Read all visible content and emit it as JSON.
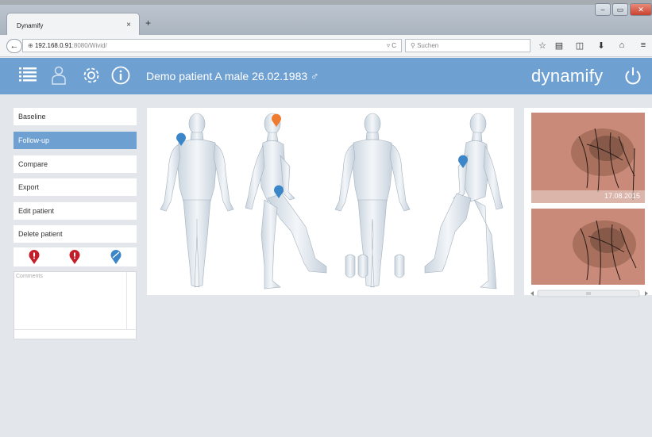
{
  "browser": {
    "tab_title": "Dynamify",
    "tab_close": "×",
    "new_tab": "+",
    "url_host": "192.168.0.91",
    "url_path": ":8080/Wivid/",
    "search_placeholder": "Suchen",
    "window_buttons": [
      "–",
      "▭",
      "✕"
    ]
  },
  "header": {
    "patient_label": "Demo patient A male 26.02.1983 ♂",
    "brand": "dynamify"
  },
  "sidebar": {
    "items": [
      {
        "label": "Baseline",
        "active": false
      },
      {
        "label": "Follow-up",
        "active": true
      },
      {
        "label": "Compare",
        "active": false
      },
      {
        "label": "Export",
        "active": false
      },
      {
        "label": "Edit patient",
        "active": false
      },
      {
        "label": "Delete patient",
        "active": false
      }
    ],
    "comments_placeholder": "Comments"
  },
  "images": {
    "dates": [
      "17.08.2015",
      ""
    ]
  },
  "colors": {
    "accent": "#6fa0d2",
    "pin_blue": "#3b86c8",
    "pin_orange": "#ee7b2f",
    "pin_red": "#c41e2a"
  },
  "icons": [
    "list-icon",
    "user-icon",
    "settings-icon",
    "info-icon",
    "power-icon",
    "star-icon",
    "reader-icon",
    "pocket-icon",
    "download-icon",
    "home-icon",
    "menu-icon"
  ]
}
